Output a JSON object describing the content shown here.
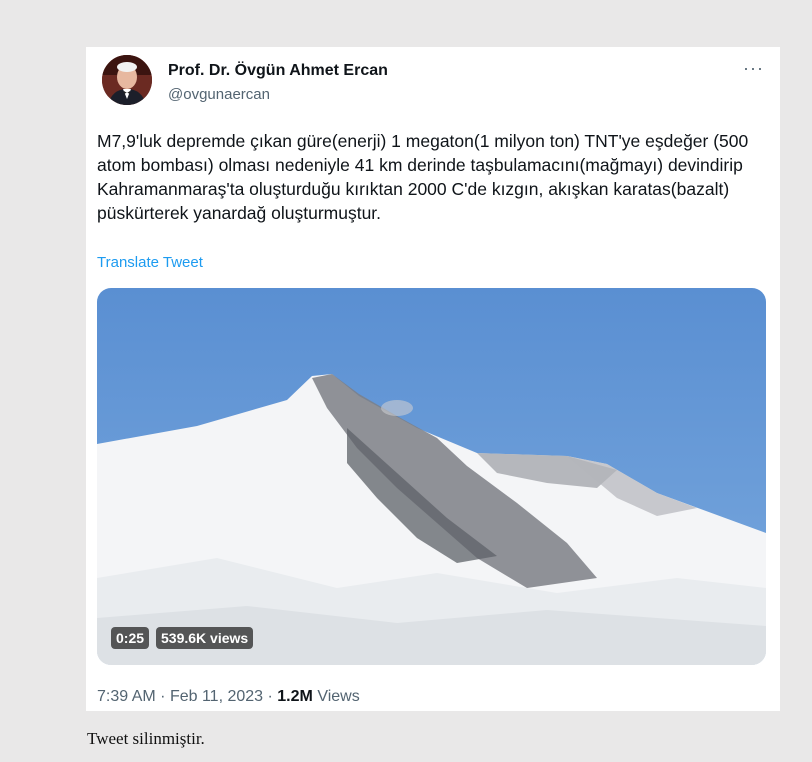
{
  "tweet": {
    "author_name": "Prof. Dr. Övgün Ahmet Ercan",
    "author_handle": "@ovgunaercan",
    "more_label": "···",
    "text": "M7,9'luk depremde çıkan güre(enerji) 1 megaton(1 milyon ton) TNT'ye eşdeğer (500 atom bombası) olması nedeniyle 41 km derinde taşbulamacını(mağmayı) devindirip Kahramanmaraş'ta oluşturduğu kırıktan 2000 C'de kızgın, akışkan karatas(bazalt) püskürterek yanardağ oluşturmuştur.",
    "translate_label": "Translate Tweet",
    "video": {
      "duration": "0:25",
      "views": "539.6K views"
    },
    "time": "7:39 AM",
    "date": "Feb 11, 2023",
    "separator": "·",
    "view_count": "1.2M",
    "views_label": "Views"
  },
  "caption": "Tweet silinmiştir.",
  "colors": {
    "link": "#1d9bf0",
    "secondary_text": "#536471",
    "sky": "#5d92d4"
  }
}
